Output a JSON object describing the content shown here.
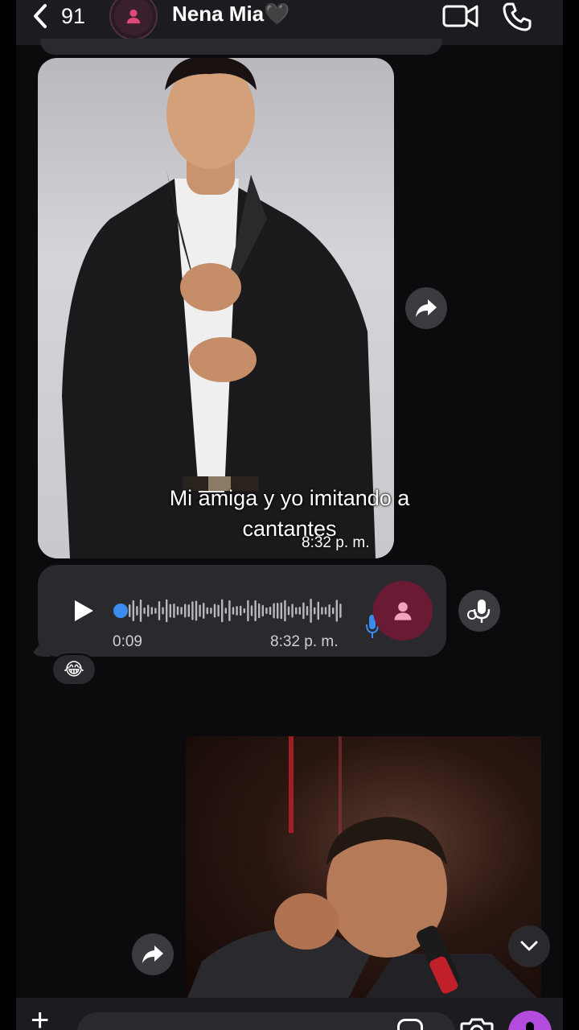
{
  "header": {
    "back_count": "91",
    "contact_name": "Nena Mia🖤"
  },
  "photo_message": {
    "caption": "Mi amiga y yo imitando a cantantes",
    "time": "8:32 p. m."
  },
  "voice_message": {
    "duration": "0:09",
    "time": "8:32 p. m.",
    "progress": 0.0
  },
  "reaction": {
    "emoji": "😂"
  },
  "composer": {
    "placeholder": ""
  },
  "colors": {
    "accent": "#b34cdd",
    "avatar_bg": "#6b1a34",
    "progress_dot": "#3a8cf0",
    "bubble": "#2a292d"
  },
  "icons": [
    "chevron-left-icon",
    "person-icon",
    "video-camera-icon",
    "phone-icon",
    "forward-icon",
    "play-icon",
    "microphone-icon",
    "transcribe-icon",
    "chevron-down-icon",
    "plus-icon",
    "sticker-icon",
    "camera-icon"
  ]
}
